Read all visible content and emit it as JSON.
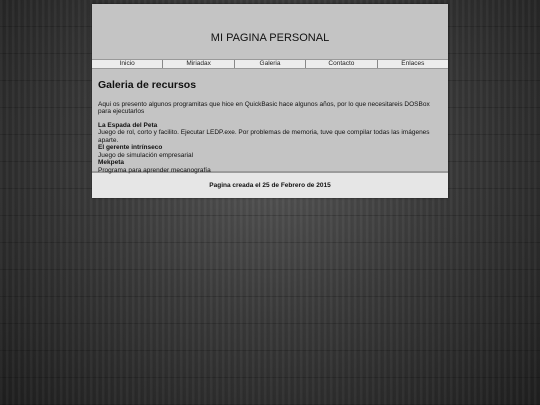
{
  "header": {
    "title": "MI PAGINA PERSONAL"
  },
  "nav": {
    "items": [
      {
        "label": "Inicio"
      },
      {
        "label": "Miriadax"
      },
      {
        "label": "Galeria"
      },
      {
        "label": "Contacto"
      },
      {
        "label": "Enlaces"
      }
    ]
  },
  "main": {
    "heading": "Galeria de recursos",
    "intro": "Aqui os presento algunos programitas que hice en QuickBasic hace algunos años, por lo que necesitareis DOSBox para ejecutarlos",
    "resources": [
      {
        "title": "La Espada del Peta",
        "description": "Juego de rol, corto y facilito. Ejecutar LEDP.exe. Por problemas de memoria, tuve que compilar todas las imágenes aparte."
      },
      {
        "title": "El gerente intrínseco",
        "description": "Juego de simulación empresarial"
      },
      {
        "title": "Mekpeta",
        "description": "Programa para aprender mecanografía"
      }
    ]
  },
  "footer": {
    "text": "Pagina creada el 25 de Febrero de 2015"
  }
}
